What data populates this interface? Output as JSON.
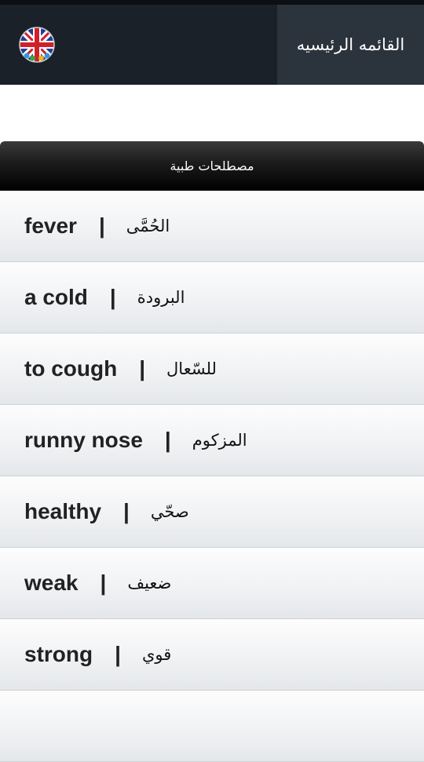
{
  "header": {
    "home_label": "القائمه الرئيسيه",
    "flag_icon": "uk-flag-icon"
  },
  "panel": {
    "title": "مصطلحات طبية"
  },
  "terms": [
    {
      "en": "fever",
      "sep": "|",
      "ar": "الحُمَّى"
    },
    {
      "en": "a cold",
      "sep": "|",
      "ar": "البرودة"
    },
    {
      "en": "to cough",
      "sep": "|",
      "ar": "للسّعال"
    },
    {
      "en": "runny nose",
      "sep": "|",
      "ar": "المزكوم"
    },
    {
      "en": "healthy",
      "sep": "|",
      "ar": "صحّي"
    },
    {
      "en": "weak",
      "sep": "|",
      "ar": "ضعيف"
    },
    {
      "en": "strong",
      "sep": "|",
      "ar": "قوي"
    }
  ],
  "colors": {
    "topbar": "#1a2129",
    "home_button": "#2b333c",
    "panel_header": "#000000",
    "row_top": "#fdfdfd",
    "row_bottom": "#e4e7ea"
  }
}
